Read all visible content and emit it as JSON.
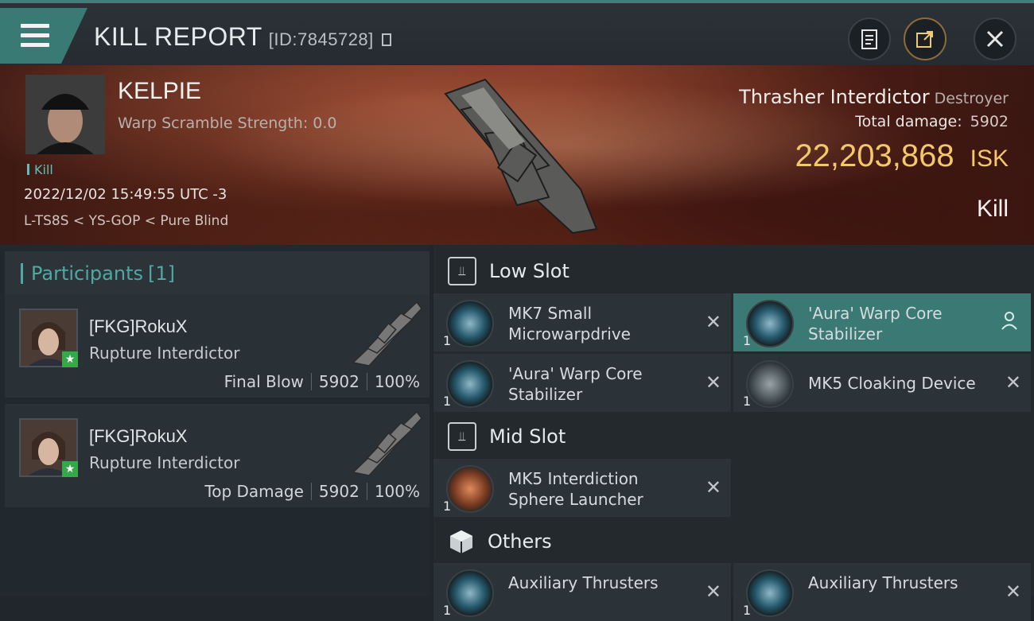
{
  "header": {
    "title": "KILL REPORT",
    "report_id": "[ID:7845728]",
    "buttons": [
      "clipboard-icon",
      "share-icon",
      "close-icon"
    ]
  },
  "victim": {
    "name": "KELPIE",
    "warp_scramble": "Warp Scramble Strength: 0.0",
    "tag": "Kill",
    "datetime": "2022/12/02 15:49:55 UTC -3",
    "location": "L-TS8S < YS-GOP < Pure Blind",
    "ship": "Thrasher Interdictor",
    "ship_class": "Destroyer",
    "total_damage_label": "Total damage:",
    "total_damage": "5902",
    "isk_value": "22,203,868",
    "isk_unit": "ISK",
    "result": "Kill"
  },
  "participants": {
    "label": "Participants",
    "count": "[1]",
    "items": [
      {
        "name": "[FKG]RokuX",
        "ship": "Rupture Interdictor",
        "role": "Final Blow",
        "damage": "5902",
        "percent": "100%"
      },
      {
        "name": "[FKG]RokuX",
        "ship": "Rupture Interdictor",
        "role": "Top Damage",
        "damage": "5902",
        "percent": "100%"
      }
    ]
  },
  "sections": {
    "low": {
      "label": "Low Slot"
    },
    "mid": {
      "label": "Mid Slot"
    },
    "others": {
      "label": "Others"
    }
  },
  "modules": {
    "low_1": {
      "name": "MK7 Small Microwarpdrive",
      "qty": "1"
    },
    "low_2": {
      "name": "'Aura' Warp Core Stabilizer",
      "qty": "1"
    },
    "low_3": {
      "name": "'Aura' Warp Core Stabilizer",
      "qty": "1"
    },
    "low_4": {
      "name": "MK5 Cloaking Device",
      "qty": "1"
    },
    "mid_1": {
      "name": "MK5 Interdiction Sphere Launcher",
      "qty": "1"
    },
    "oth_1": {
      "name": "Auxiliary Thrusters",
      "qty": "1"
    },
    "oth_2": {
      "name": "Auxiliary Thrusters",
      "qty": "1"
    }
  },
  "colors": {
    "accent": "#3b7a74",
    "isk": "#f2c86b",
    "teal_text": "#4ea9a2"
  }
}
